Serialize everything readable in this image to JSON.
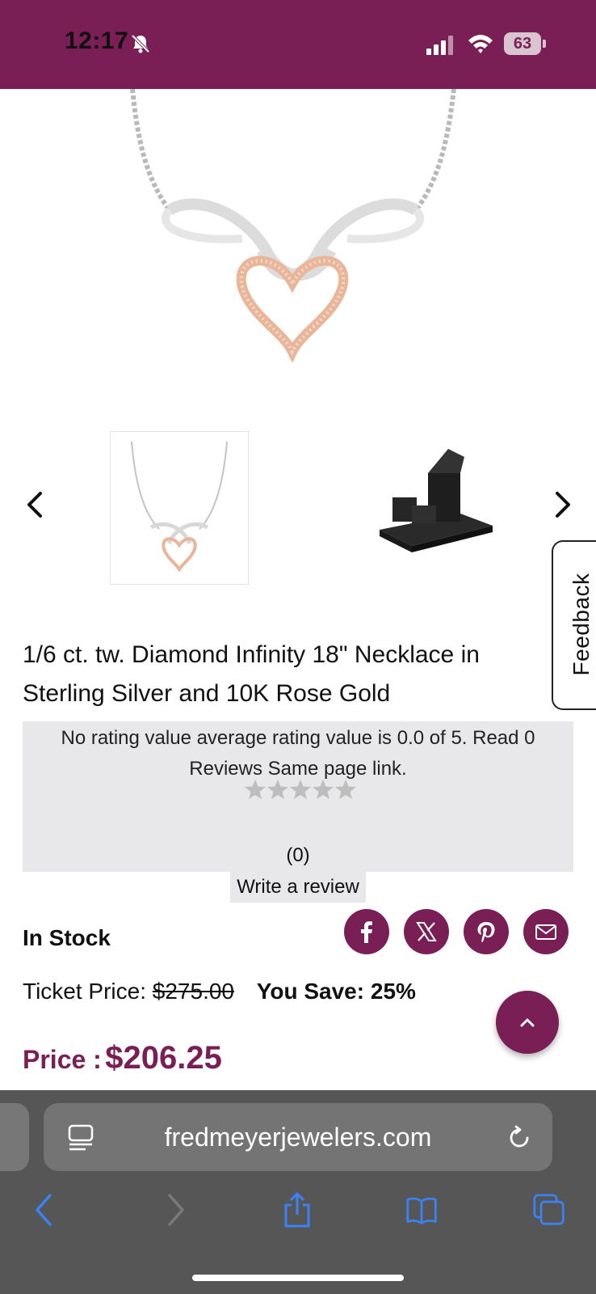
{
  "status_bar": {
    "time": "12:17",
    "battery": "63"
  },
  "product": {
    "title": "1/6 ct. tw. Diamond Infinity 18\" Necklace in Sterling Silver and 10K Rose Gold",
    "availability": "In Stock",
    "ticket_label": "Ticket Price:",
    "ticket_price": "$275.00",
    "save_label": "You Save:",
    "save_value": "25%",
    "price_label": "Price :",
    "price_value": "$206.25"
  },
  "rating": {
    "text": "No rating value average rating value is 0.0 of 5. Read 0 Reviews Same page link.",
    "count": "(0)",
    "write_review": "Write a review",
    "stars": 0
  },
  "feedback_label": "Feedback",
  "browser": {
    "url": "fredmeyerjewelers.com"
  },
  "colors": {
    "brand": "#7a1f55",
    "chrome": "#565656",
    "link": "#3a82f7"
  }
}
